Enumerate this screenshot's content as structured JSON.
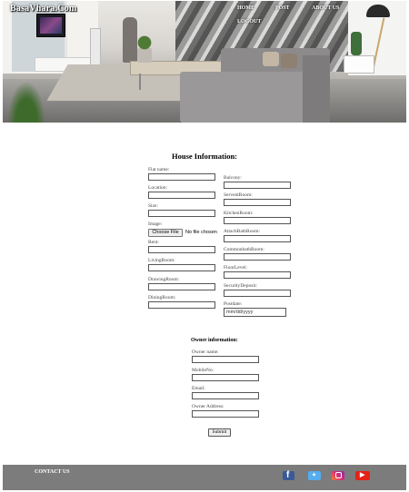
{
  "header": {
    "brand": "BasaVhara.Com",
    "nav": [
      "HOME",
      "POST",
      "ABOUT US",
      "LOGOUT"
    ]
  },
  "house_form": {
    "title": "House Information:",
    "left_fields": [
      "Flat name:",
      "Location:",
      "Size:",
      "Image:",
      "Rent:",
      "LivingRoom:",
      "DrawingRoom:",
      "DiningRoom:"
    ],
    "right_fields": [
      "Balcony:",
      "ServentRoom:",
      "KitchenRoom:",
      "AttachBathRoom:",
      "CommonbathRoom:",
      "FloorLevel:",
      "SecurityDeposit:",
      "Postdate:"
    ],
    "file_button": "Choose File",
    "file_status": "No file chosen",
    "date_placeholder": "mm/dd/yyyy"
  },
  "owner_form": {
    "title": "Owner information:",
    "fields": [
      "Owner name:",
      "MobileNo:",
      "Email:",
      "Owner Address:"
    ]
  },
  "submit_label": "Submit",
  "footer": {
    "contact": "CONTACT US",
    "social": [
      "facebook-icon",
      "twitter-icon",
      "instagram-icon",
      "youtube-icon"
    ]
  },
  "colors": {
    "footer_bg": "#7c7c7c",
    "facebook": "#3b5998",
    "twitter": "#55acee",
    "youtube": "#e62117"
  }
}
